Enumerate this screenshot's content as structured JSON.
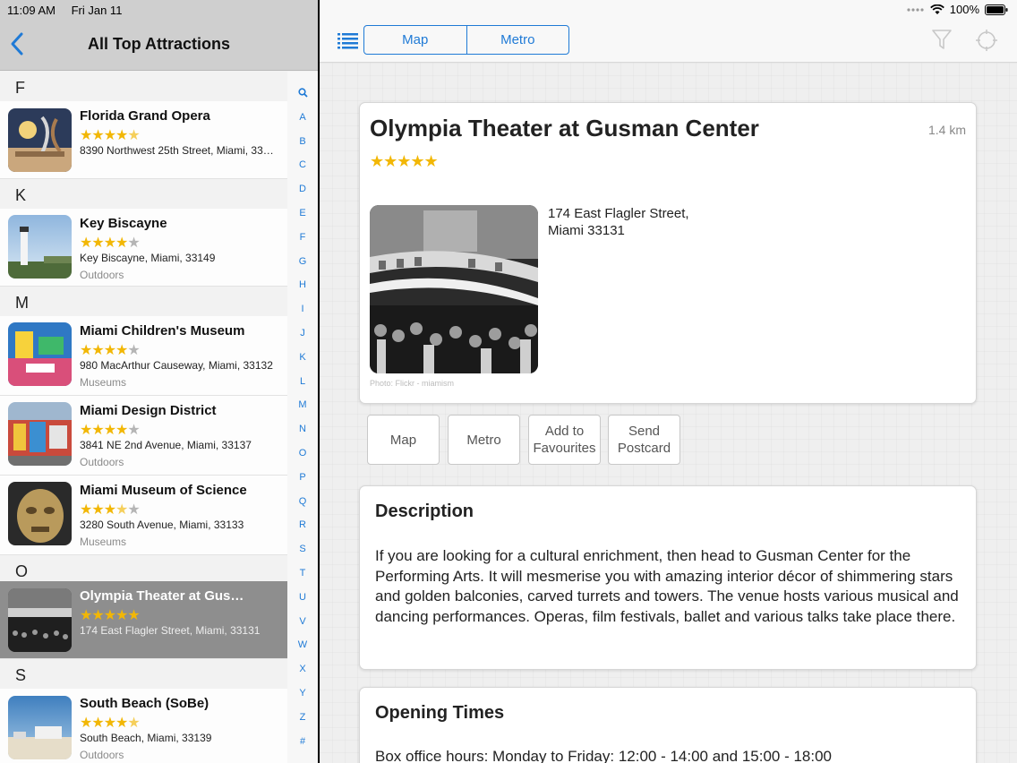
{
  "status_bar": {
    "time": "11:09 AM",
    "date": "Fri Jan 11",
    "battery": "100%"
  },
  "master": {
    "title": "All Top Attractions",
    "sections": [
      {
        "letter": "F"
      },
      {
        "letter": "K"
      },
      {
        "letter": "M"
      },
      {
        "letter": "O"
      },
      {
        "letter": "S"
      }
    ],
    "items": [
      {
        "name": "Florida Grand Opera",
        "rating": 4.5,
        "address": "8390 Northwest 25th Street, Miami, 33…",
        "category": ""
      },
      {
        "name": "Key Biscayne",
        "rating": 4,
        "address": "Key Biscayne, Miami, 33149",
        "category": "Outdoors"
      },
      {
        "name": "Miami Children's Museum",
        "rating": 4,
        "address": "980 MacArthur Causeway, Miami, 33132",
        "category": "Museums"
      },
      {
        "name": "Miami Design District",
        "rating": 4,
        "address": "3841 NE 2nd Avenue, Miami, 33137",
        "category": "Outdoors"
      },
      {
        "name": "Miami Museum of Science",
        "rating": 3.5,
        "address": "3280 South  Avenue, Miami, 33133",
        "category": "Museums"
      },
      {
        "name": "Olympia Theater at Gus…",
        "rating": 5,
        "address": "174 East Flagler Street, Miami, 33131",
        "category": ""
      },
      {
        "name": "South Beach (SoBe)",
        "rating": 4.5,
        "address": "South Beach, Miami, 33139",
        "category": "Outdoors"
      }
    ],
    "index": [
      "Q",
      "A",
      "B",
      "C",
      "D",
      "E",
      "F",
      "G",
      "H",
      "I",
      "J",
      "K",
      "L",
      "M",
      "N",
      "O",
      "P",
      "Q",
      "R",
      "S",
      "T",
      "U",
      "V",
      "W",
      "X",
      "Y",
      "Z",
      "#"
    ]
  },
  "toolbar": {
    "segments": [
      "Map",
      "Metro"
    ]
  },
  "detail": {
    "title": "Olympia Theater at Gusman Center",
    "distance": "1.4 km",
    "rating": 5,
    "address_line1": "174 East Flagler Street,",
    "address_line2": "Miami 33131",
    "photo_credit": "Photo: Flickr - miamism",
    "actions": [
      "Map",
      "Metro",
      "Add to Favourites",
      "Send Postcard"
    ],
    "description_heading": "Description",
    "description": "If you are looking for a cultural enrichment, then head to Gusman Center for the Performing Arts. It will mesmerise you with amazing interior décor of shimmering stars and golden balconies, carved turrets and towers. The venue hosts various musical and dancing performances. Operas, film festivals, ballet and various talks take place there.",
    "opening_heading": "Opening Times",
    "opening_text": "Box office hours: Monday to Friday: 12:00 - 14:00 and 15:00 - 18:00"
  },
  "colors": {
    "accent": "#1f7ad6",
    "star": "#f2b705",
    "selected_row": "#8e8e8e"
  }
}
